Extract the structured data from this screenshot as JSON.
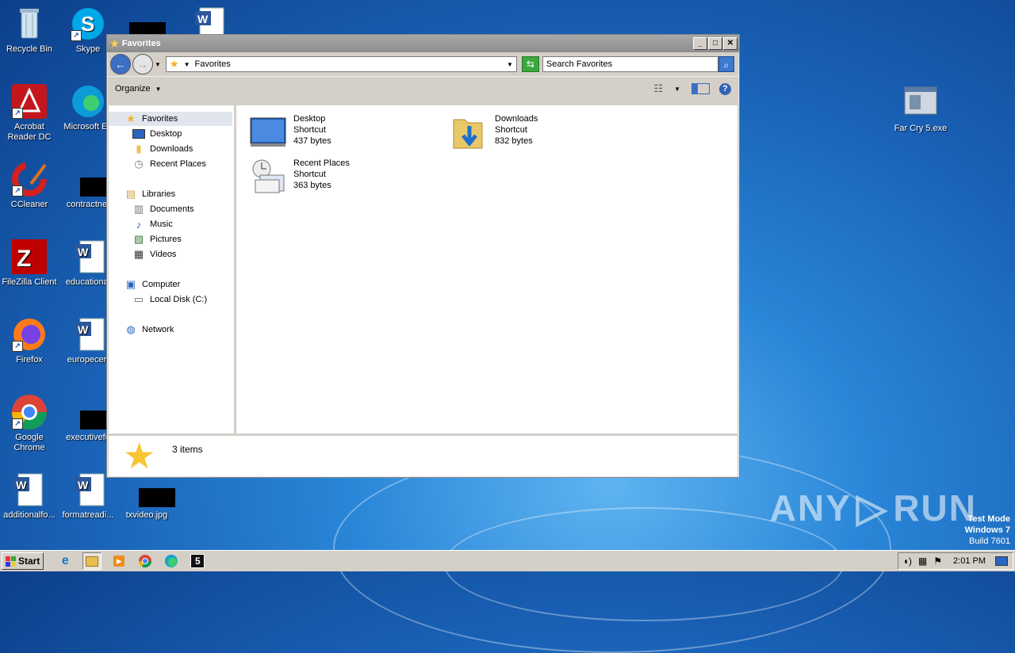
{
  "desktop": {
    "icons": [
      {
        "label": "Recycle Bin"
      },
      {
        "label": "Skype"
      },
      {
        "label": "Acrobat Reader DC"
      },
      {
        "label": "Microsoft Ed"
      },
      {
        "label": "CCleaner"
      },
      {
        "label": "contractnet"
      },
      {
        "label": "FileZilla Client"
      },
      {
        "label": "educational"
      },
      {
        "label": "Firefox"
      },
      {
        "label": "europecert"
      },
      {
        "label": "Google Chrome"
      },
      {
        "label": "executivefu"
      },
      {
        "label": "additionalfo..."
      },
      {
        "label": "formatreadi..."
      },
      {
        "label": "txvideo.jpg"
      },
      {
        "label": "Far Cry 5.exe"
      }
    ]
  },
  "window": {
    "title": "Favorites",
    "address": "Favorites",
    "search_placeholder": "Search Favorites",
    "organize_label": "Organize",
    "nav": {
      "favorites": "Favorites",
      "desktop": "Desktop",
      "downloads": "Downloads",
      "recent_places": "Recent Places",
      "libraries": "Libraries",
      "documents": "Documents",
      "music": "Music",
      "pictures": "Pictures",
      "videos": "Videos",
      "computer": "Computer",
      "local_disk": "Local Disk (C:)",
      "network": "Network"
    },
    "files": [
      {
        "name": "Desktop",
        "type": "Shortcut",
        "size": "437 bytes"
      },
      {
        "name": "Downloads",
        "type": "Shortcut",
        "size": "832 bytes"
      },
      {
        "name": "Recent Places",
        "type": "Shortcut",
        "size": "363 bytes"
      }
    ],
    "status_count": "3 items"
  },
  "taskbar": {
    "start_label": "Start",
    "clock": "2:01 PM"
  },
  "watermark": {
    "left": "ANY",
    "right": "RUN"
  },
  "test_mode": {
    "line1": "Test Mode",
    "line2": "Windows 7",
    "line3": "Build 7601"
  }
}
